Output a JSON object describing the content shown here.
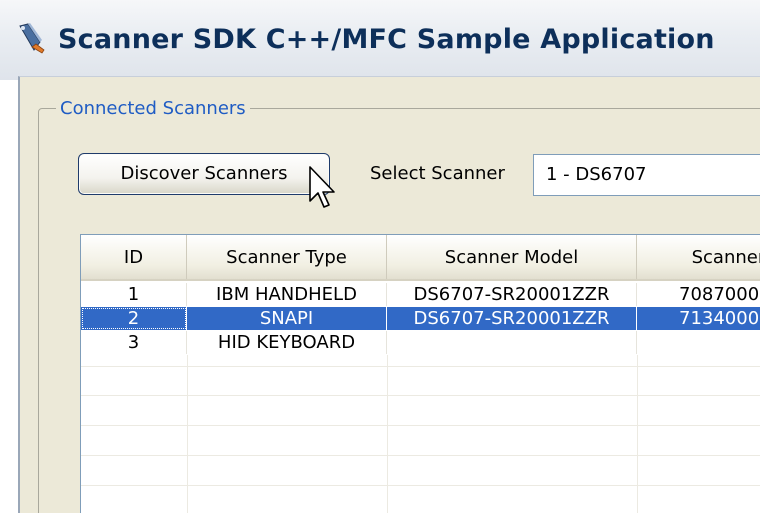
{
  "window": {
    "title": "Scanner SDK C++/MFC Sample Application",
    "icon": "scanner-app-icon"
  },
  "group": {
    "label": "Connected Scanners"
  },
  "toolbar": {
    "discover_label": "Discover Scanners",
    "select_label": "Select Scanner",
    "select_value": "1 - DS6707"
  },
  "table": {
    "columns": [
      "ID",
      "Scanner Type",
      "Scanner Model",
      "Scanner S"
    ],
    "rows": [
      [
        "1",
        "IBM HANDHELD",
        "DS6707-SR20001ZZR",
        "7087000"
      ],
      [
        "2",
        "SNAPI",
        "DS6707-SR20001ZZR",
        "7134000"
      ],
      [
        "3",
        "HID KEYBOARD",
        "",
        ""
      ]
    ],
    "selected_row_index": 1
  },
  "colors": {
    "title_text": "#0d2f5a",
    "group_label": "#1f5cc4",
    "selection": "#3169c6",
    "dialog_bg": "#ece9d8"
  }
}
